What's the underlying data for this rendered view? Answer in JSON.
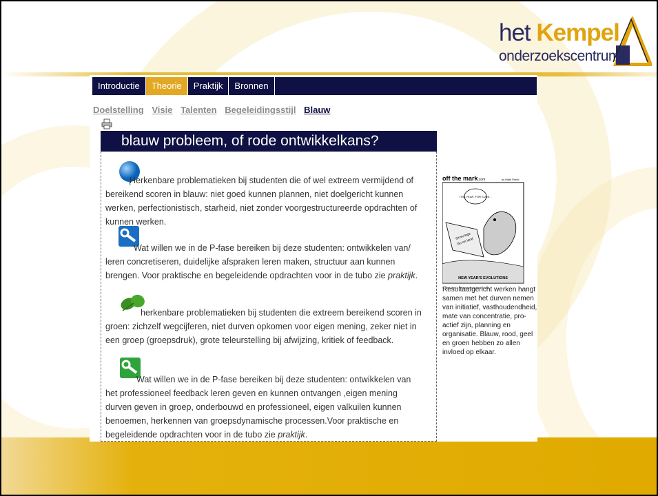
{
  "logo": {
    "het": "het",
    "kempel": "Kempel",
    "sub": "onderzoekscentrum"
  },
  "nav": {
    "tabs": [
      {
        "label": "Introductie",
        "active": false
      },
      {
        "label": "Theorie",
        "active": true
      },
      {
        "label": "Praktijk",
        "active": false
      },
      {
        "label": "Bronnen",
        "active": false
      }
    ]
  },
  "subnav": {
    "links": [
      "Doelstelling",
      "Visie",
      "Talenten",
      "Begeleidingsstijl",
      "Blauw"
    ],
    "active": "Blauw"
  },
  "article": {
    "title": "blauw probleem, of rode ontwikkelkans?",
    "p1": "Herkenbare problematieken bij studenten die of wel extreem vermijdend of bereikend scoren in blauw: niet goed kunnen plannen, niet doelgericht kunnen werken, perfectionistisch, starheid, niet zonder voorgestructureerde opdrachten of kunnen werken.",
    "p2": "Wat willen we in de P-fase bereiken bij deze studenten: ontwikkelen van/ leren concretiseren, duidelijke afspraken leren maken, structuur aan kunnen brengen. Voor praktische en begeleidende opdrachten voor in de tubo zie ",
    "p2_link": "praktijk",
    "p3": "herkenbare problematieken bij studenten die extreem bereikend scoren in groen: zichzelf wegcijferen, niet durven opkomen voor eigen mening, zeker niet in een groep (groepsdruk), grote teleurstelling bij afwijzing, kritiek of feedback.",
    "p4": "Wat willen we in de P-fase bereiken bij deze studenten: ontwikkelen van het professioneel feedback leren geven en kunnen ontvangen ,eigen mening durven geven in groep, onderbouwd en professioneel, eigen valkuilen kunnen benoemen, herkennen van groepsdynamische processen.Voor praktische en begeleidende opdrachten voor in de tubo zie ",
    "p4_link": "praktijk"
  },
  "cartoon": {
    "brand": "off the mark",
    "brand_suffix": ".com",
    "author": "by Mark Parisi",
    "bubble": "THIS YEAR, FOR SURE...",
    "caption": "NEW YEAR'S EVOLUTIONS",
    "credit": "© Mark Parisi, Permission required for use."
  },
  "sidebar": {
    "text": "Resultaatgericht werken hangt samen met het durven nemen van initiatief, vasthoudendheid, mate van concentratie, pro-actief zijn, planning en organisatie. Blauw, rood, geel en groen hebben zo allen invloed op elkaar."
  },
  "colors": {
    "navy": "#0f1043",
    "gold": "#e3a823",
    "band": "#e0aa00"
  },
  "icons": [
    "printer-icon",
    "blue-balloon-icon",
    "blue-tool-icon",
    "green-leaves-icon",
    "green-tool-icon"
  ]
}
